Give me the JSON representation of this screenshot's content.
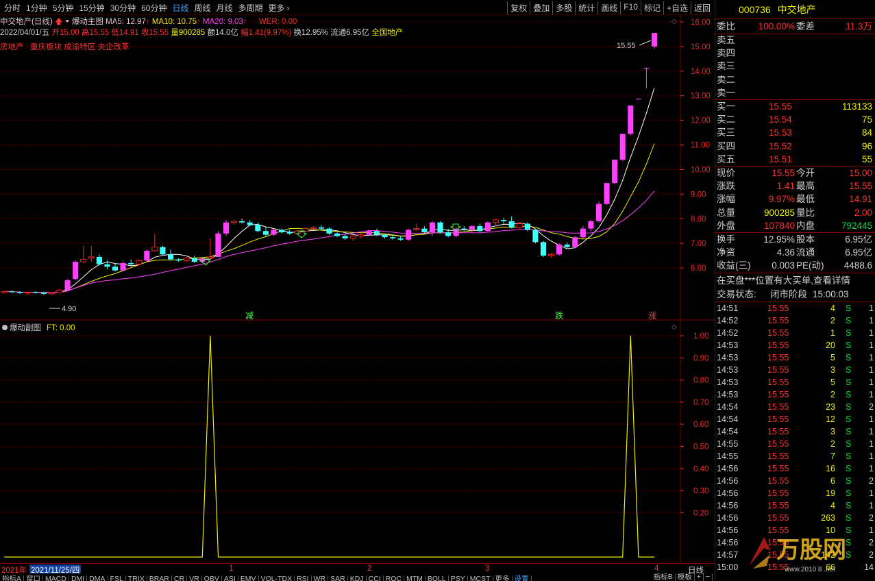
{
  "toolbar": {
    "left": [
      "分时",
      "1分钟",
      "5分钟",
      "15分钟",
      "30分钟",
      "60分钟",
      "日线",
      "周线",
      "月线",
      "多周期",
      "更多"
    ],
    "active": "日线",
    "more_glyph": "›",
    "right": [
      "复权",
      "叠加",
      "多股",
      "统计",
      "画线",
      "F10",
      "标记",
      "+自选",
      "返回"
    ]
  },
  "info": {
    "stock_label": "中交地产(日线)",
    "indicator_main": "爆动主图",
    "ma5": "MA5: 12.97",
    "ma10": "MA10: 10.75",
    "ma20": "MA20: 9.03",
    "wer": "WER: 0.00",
    "date": "2022/04/01/五",
    "open": "开15.00",
    "high": "高15.55",
    "low": "低14.91",
    "close": "收15.55",
    "vol": "量900285",
    "amount": "额14.0亿",
    "change": "幅1.41(9.97%)",
    "turnover": "换12.95%",
    "float": "流通6.95亿",
    "region": "全国地产",
    "tags": [
      "房地产",
      "重庆板块",
      "成渝特区",
      "央企改革"
    ]
  },
  "sub": {
    "indicator": "爆动副图",
    "value": "FT: 0.00"
  },
  "chart_labels": {
    "max_price": "15.55",
    "min_price": "4.90",
    "sig_jian": "减",
    "sig_die": "跌",
    "sig_zhang": "涨"
  },
  "chart_data": [
    {
      "type": "candlestick",
      "title": "",
      "y_ticks": [
        6.0,
        7.0,
        8.0,
        9.0,
        10.0,
        11.0,
        12.0,
        13.0,
        14.0,
        15.0,
        16.0
      ],
      "ylim": [
        5.0,
        16.0
      ],
      "ohlc": [
        [
          5.0,
          5.08,
          4.95,
          5.05
        ],
        [
          5.05,
          5.1,
          4.98,
          5.02
        ],
        [
          5.02,
          5.06,
          4.95,
          4.98
        ],
        [
          4.98,
          5.04,
          4.92,
          5.01
        ],
        [
          5.01,
          5.05,
          4.96,
          5.0
        ],
        [
          5.0,
          5.03,
          4.9,
          4.95
        ],
        [
          4.95,
          5.02,
          4.9,
          4.99
        ],
        [
          4.99,
          5.15,
          4.97,
          5.1
        ],
        [
          5.1,
          5.55,
          5.08,
          5.5
        ],
        [
          5.55,
          6.3,
          5.5,
          6.25
        ],
        [
          6.25,
          6.9,
          6.2,
          6.35
        ],
        [
          6.4,
          6.9,
          6.25,
          6.45
        ],
        [
          6.45,
          6.55,
          6.1,
          6.15
        ],
        [
          6.15,
          6.3,
          5.95,
          6.05
        ],
        [
          6.05,
          6.2,
          5.85,
          5.9
        ],
        [
          5.9,
          6.3,
          5.85,
          6.2
        ],
        [
          6.2,
          6.35,
          6.05,
          6.15
        ],
        [
          6.15,
          6.35,
          6.1,
          6.3
        ],
        [
          6.3,
          6.75,
          6.25,
          6.7
        ],
        [
          6.7,
          7.4,
          6.65,
          6.85
        ],
        [
          6.85,
          6.9,
          6.5,
          6.55
        ],
        [
          6.55,
          6.75,
          6.3,
          6.35
        ],
        [
          6.35,
          6.4,
          6.25,
          6.3
        ],
        [
          6.3,
          6.45,
          6.25,
          6.4
        ],
        [
          6.4,
          6.5,
          6.2,
          6.25
        ],
        [
          6.25,
          6.45,
          6.2,
          6.4
        ],
        [
          6.4,
          7.2,
          6.35,
          6.45
        ],
        [
          6.45,
          7.5,
          6.45,
          7.4
        ],
        [
          7.4,
          7.95,
          7.3,
          7.85
        ],
        [
          7.85,
          7.95,
          7.75,
          7.9
        ],
        [
          7.9,
          8.0,
          7.8,
          7.85
        ],
        [
          7.85,
          7.95,
          7.7,
          7.75
        ],
        [
          7.75,
          7.85,
          7.45,
          7.5
        ],
        [
          7.5,
          7.65,
          7.3,
          7.35
        ],
        [
          7.35,
          7.6,
          7.3,
          7.55
        ],
        [
          7.55,
          7.6,
          7.4,
          7.45
        ],
        [
          7.45,
          7.55,
          7.35,
          7.4
        ],
        [
          7.4,
          7.55,
          7.35,
          7.5
        ],
        [
          7.5,
          7.65,
          7.45,
          7.6
        ],
        [
          7.6,
          7.7,
          7.55,
          7.65
        ],
        [
          7.65,
          7.75,
          7.55,
          7.6
        ],
        [
          7.6,
          7.65,
          7.35,
          7.4
        ],
        [
          7.4,
          7.45,
          7.25,
          7.3
        ],
        [
          7.3,
          7.4,
          7.15,
          7.2
        ],
        [
          7.2,
          7.35,
          7.1,
          7.3
        ],
        [
          7.3,
          7.4,
          7.2,
          7.35
        ],
        [
          7.35,
          7.55,
          7.3,
          7.5
        ],
        [
          7.5,
          7.6,
          7.3,
          7.35
        ],
        [
          7.35,
          7.4,
          7.2,
          7.25
        ],
        [
          7.25,
          7.35,
          7.15,
          7.2
        ],
        [
          7.2,
          7.3,
          7.1,
          7.15
        ],
        [
          7.15,
          7.6,
          7.1,
          7.55
        ],
        [
          7.55,
          7.8,
          7.5,
          7.6
        ],
        [
          7.6,
          7.7,
          7.4,
          7.45
        ],
        [
          7.45,
          7.9,
          7.3,
          7.85
        ],
        [
          7.85,
          7.9,
          7.4,
          7.45
        ],
        [
          7.45,
          7.6,
          7.25,
          7.3
        ],
        [
          7.3,
          7.65,
          7.25,
          7.6
        ],
        [
          7.6,
          7.7,
          7.5,
          7.55
        ],
        [
          7.55,
          7.75,
          7.45,
          7.7
        ],
        [
          7.7,
          7.8,
          7.45,
          7.5
        ],
        [
          7.5,
          7.9,
          7.45,
          7.85
        ],
        [
          7.85,
          8.0,
          7.7,
          7.95
        ],
        [
          7.95,
          8.05,
          7.8,
          7.9
        ],
        [
          7.9,
          8.1,
          7.6,
          7.65
        ],
        [
          7.65,
          7.85,
          7.55,
          7.8
        ],
        [
          7.8,
          7.85,
          7.5,
          7.55
        ],
        [
          7.55,
          7.6,
          7.0,
          7.05
        ],
        [
          7.05,
          7.1,
          6.45,
          6.5
        ],
        [
          6.5,
          6.6,
          6.4,
          6.55
        ],
        [
          6.55,
          7.0,
          6.5,
          6.95
        ],
        [
          6.95,
          7.05,
          6.8,
          6.85
        ],
        [
          6.85,
          7.3,
          6.8,
          7.25
        ],
        [
          7.25,
          7.7,
          7.2,
          7.6
        ],
        [
          7.6,
          7.95,
          7.5,
          7.9
        ],
        [
          7.9,
          8.7,
          7.85,
          8.6
        ],
        [
          8.6,
          9.45,
          8.55,
          9.45
        ],
        [
          9.45,
          10.4,
          9.4,
          10.4
        ],
        [
          10.4,
          11.45,
          10.35,
          11.45
        ],
        [
          11.45,
          12.6,
          11.4,
          12.6
        ],
        [
          12.85,
          12.9,
          12.85,
          12.88
        ],
        [
          14.13,
          14.15,
          13.3,
          14.13
        ],
        [
          15.0,
          15.55,
          14.91,
          15.55
        ]
      ],
      "ma_series": [
        {
          "name": "MA5",
          "color": "#ffffff"
        },
        {
          "name": "MA10",
          "color": "#f0f000"
        },
        {
          "name": "MA20",
          "color": "#ff40ff"
        }
      ]
    },
    {
      "type": "line",
      "title": "",
      "y_ticks": [
        0.2,
        0.3,
        0.4,
        0.5,
        0.6,
        0.7,
        0.8,
        0.9,
        1.0
      ],
      "ylim": [
        0.0,
        1.0
      ],
      "series": [
        {
          "name": "FT",
          "color": "#f0f000",
          "spikes_at_index": [
            26,
            79
          ]
        }
      ]
    }
  ],
  "date_axis": {
    "year": "2021年",
    "cursor_date": "2021/11/25/四",
    "months": [
      "1",
      "2",
      "3",
      "4"
    ],
    "period": "日线"
  },
  "bottom_tabs": [
    "指标A",
    "窗口",
    "MACD",
    "DMI",
    "DMA",
    "FSL",
    "TRIX",
    "BRAR",
    "CR",
    "VR",
    "OBV",
    "ASI",
    "EMV",
    "VOL-TDX",
    "RSI",
    "WR",
    "SAR",
    "KDJ",
    "CCI",
    "ROC",
    "MTM",
    "BOLL",
    "PSY",
    "MCST",
    "更多",
    "设置"
  ],
  "bottom_right": [
    "指标B",
    "模板",
    "+",
    "−"
  ],
  "quote": {
    "code": "000736",
    "name": "中交地产",
    "weibi_label": "委比",
    "weibi": "100.00%",
    "weicha_label": "委差",
    "weicha": "11.3万",
    "sell": [
      [
        "卖五",
        "",
        ""
      ],
      [
        "卖四",
        "",
        ""
      ],
      [
        "卖三",
        "",
        ""
      ],
      [
        "卖二",
        "",
        ""
      ],
      [
        "卖一",
        "",
        ""
      ]
    ],
    "buy": [
      [
        "买一",
        "15.55",
        "113133"
      ],
      [
        "买二",
        "15.54",
        "75"
      ],
      [
        "买三",
        "15.53",
        "84"
      ],
      [
        "买四",
        "15.52",
        "96"
      ],
      [
        "买五",
        "15.51",
        "55"
      ]
    ],
    "stats": [
      [
        "现价",
        "15.55",
        "今开",
        "15.00"
      ],
      [
        "涨跌",
        "1.41",
        "最高",
        "15.55"
      ],
      [
        "涨幅",
        "9.97%",
        "最低",
        "14.91"
      ],
      [
        "总量",
        "900285",
        "量比",
        "2.00"
      ],
      [
        "外盘",
        "107840",
        "内盘",
        "792445"
      ]
    ],
    "fund": [
      [
        "换手",
        "12.95%",
        "股本",
        "6.95亿"
      ],
      [
        "净资",
        "4.36",
        "流通",
        "6.95亿"
      ],
      [
        "收益(三)",
        "0.003",
        "PE(动)",
        "4488.6"
      ]
    ],
    "notice": "在买盘***位置有大买单,查看详情",
    "status_label": "交易状态:",
    "status": "闭市阶段",
    "status_time": "15:00:03",
    "ticks": [
      [
        "14:51",
        "15.55",
        "4",
        "S",
        "1"
      ],
      [
        "14:52",
        "15.55",
        "2",
        "S",
        "1"
      ],
      [
        "14:52",
        "15.55",
        "1",
        "S",
        "1"
      ],
      [
        "14:53",
        "15.55",
        "20",
        "S",
        "1"
      ],
      [
        "14:53",
        "15.55",
        "5",
        "S",
        "1"
      ],
      [
        "14:53",
        "15.55",
        "3",
        "S",
        "1"
      ],
      [
        "14:53",
        "15.55",
        "5",
        "S",
        "1"
      ],
      [
        "14:53",
        "15.55",
        "2",
        "S",
        "1"
      ],
      [
        "14:54",
        "15.55",
        "23",
        "S",
        "2"
      ],
      [
        "14:54",
        "15.55",
        "12",
        "S",
        "1"
      ],
      [
        "14:54",
        "15.55",
        "3",
        "S",
        "1"
      ],
      [
        "14:55",
        "15.55",
        "2",
        "S",
        "1"
      ],
      [
        "14:55",
        "15.55",
        "7",
        "S",
        "1"
      ],
      [
        "14:56",
        "15.55",
        "16",
        "S",
        "1"
      ],
      [
        "14:56",
        "15.55",
        "6",
        "S",
        "2"
      ],
      [
        "14:56",
        "15.55",
        "19",
        "S",
        "1"
      ],
      [
        "14:56",
        "15.55",
        "4",
        "S",
        "1"
      ],
      [
        "14:56",
        "15.55",
        "263",
        "S",
        "2"
      ],
      [
        "14:56",
        "15.55",
        "10",
        "S",
        "1"
      ],
      [
        "14:56",
        "15.55",
        "",
        "S",
        "2"
      ],
      [
        "14:57",
        "15.55",
        "142",
        "S",
        "2"
      ],
      [
        "15:00",
        "15.55",
        "66",
        "",
        "14"
      ]
    ]
  },
  "watermark": "万股网",
  "watermark_url": "www.2010 8 .net",
  "colors": {
    "up": "#ff40ff",
    "down": "#40ffff",
    "neutral_up": "#ff2020",
    "grid": "#800000",
    "axis": "#ff2020"
  }
}
